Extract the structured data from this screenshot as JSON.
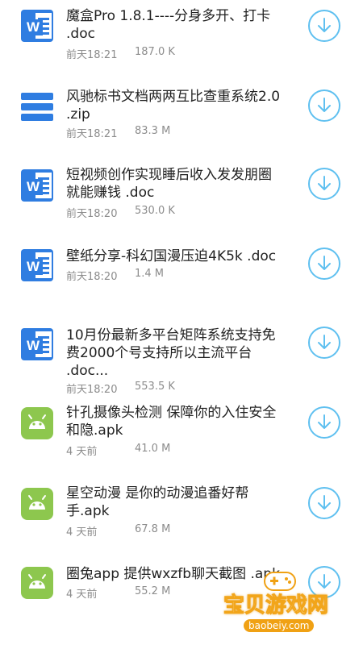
{
  "files": [
    {
      "type": "doc",
      "name": "魔盒Pro 1.8.1----分身多开、打卡\n.doc",
      "time": "前天18:21",
      "size": "187.0 K"
    },
    {
      "type": "zip",
      "name": "风驰标书文档两两互比查重系统2.0\n.zip",
      "time": "前天18:21",
      "size": "83.3 M"
    },
    {
      "type": "doc",
      "name": "短视频创作实现睡后收入发发朋圈\n就能赚钱 .doc",
      "time": "前天18:20",
      "size": "530.0 K"
    },
    {
      "type": "doc",
      "name": "壁纸分享-科幻国漫压迫4K5k .doc",
      "time": "前天18:20",
      "size": "1.4 M"
    },
    {
      "type": "doc",
      "name": "10月份最新多平台矩阵系统支持免\n费2000个号支持所以主流平台\n.doc...",
      "time": "前天18:20",
      "size": "553.5 K"
    },
    {
      "type": "apk",
      "name": "针孔摄像头检测 保障你的入住安全\n和隐.apk",
      "time": "4 天前",
      "size": "41.0 M"
    },
    {
      "type": "apk",
      "name": "星空动漫 是你的动漫追番好帮\n手.apk",
      "time": "4 天前",
      "size": "67.8 M"
    },
    {
      "type": "apk",
      "name": "圈兔app 提供wxzfb聊天截图 .apk",
      "time": "4 天前",
      "size": "55.2 M"
    }
  ],
  "watermark": {
    "text": "宝贝游戏网",
    "url": "baobeiy.com"
  },
  "colors": {
    "accent": "#5fc0f0",
    "doc_icon": "#2f7de1",
    "apk_icon": "#8dc74e"
  }
}
